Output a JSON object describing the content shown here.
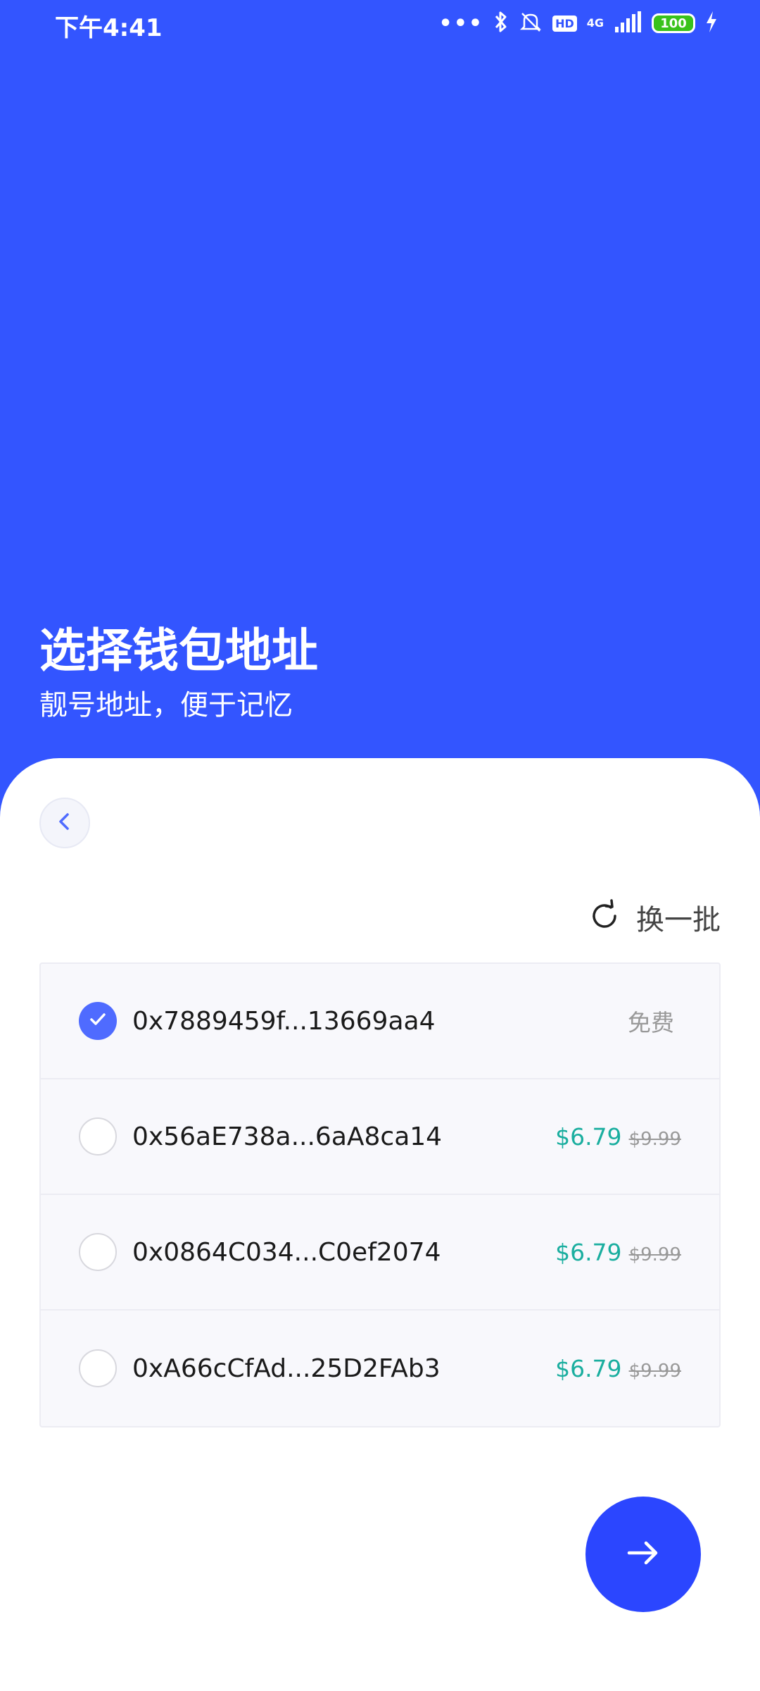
{
  "status_bar": {
    "time": "下午4:41",
    "dots": "•••",
    "hd": "HD",
    "network": "4G",
    "battery": "100",
    "icons": [
      "bluetooth-icon",
      "mute-icon",
      "hd-icon",
      "signal-icon",
      "battery-icon",
      "charging-icon"
    ]
  },
  "header": {
    "title": "选择钱包地址",
    "subtitle": "靓号地址，便于记忆"
  },
  "sheet": {
    "refresh_label": "换一批",
    "addresses": [
      {
        "address": "0x7889459f...13669aa4",
        "price": "免费",
        "selected": true
      },
      {
        "address": "0x56aE738a...6aA8ca14",
        "price": "$6.79",
        "old_price": "$9.99",
        "selected": false
      },
      {
        "address": "0x0864C034...C0ef2074",
        "price": "$6.79",
        "old_price": "$9.99",
        "selected": false
      },
      {
        "address": "0xA66cCfAd...25D2FAb3",
        "price": "$6.79",
        "old_price": "$9.99",
        "selected": false
      }
    ]
  },
  "colors": {
    "brand": "#3355FF",
    "accent_button": "#2B46FF",
    "checked": "#4F6BFF",
    "price": "#1AAE9F"
  }
}
